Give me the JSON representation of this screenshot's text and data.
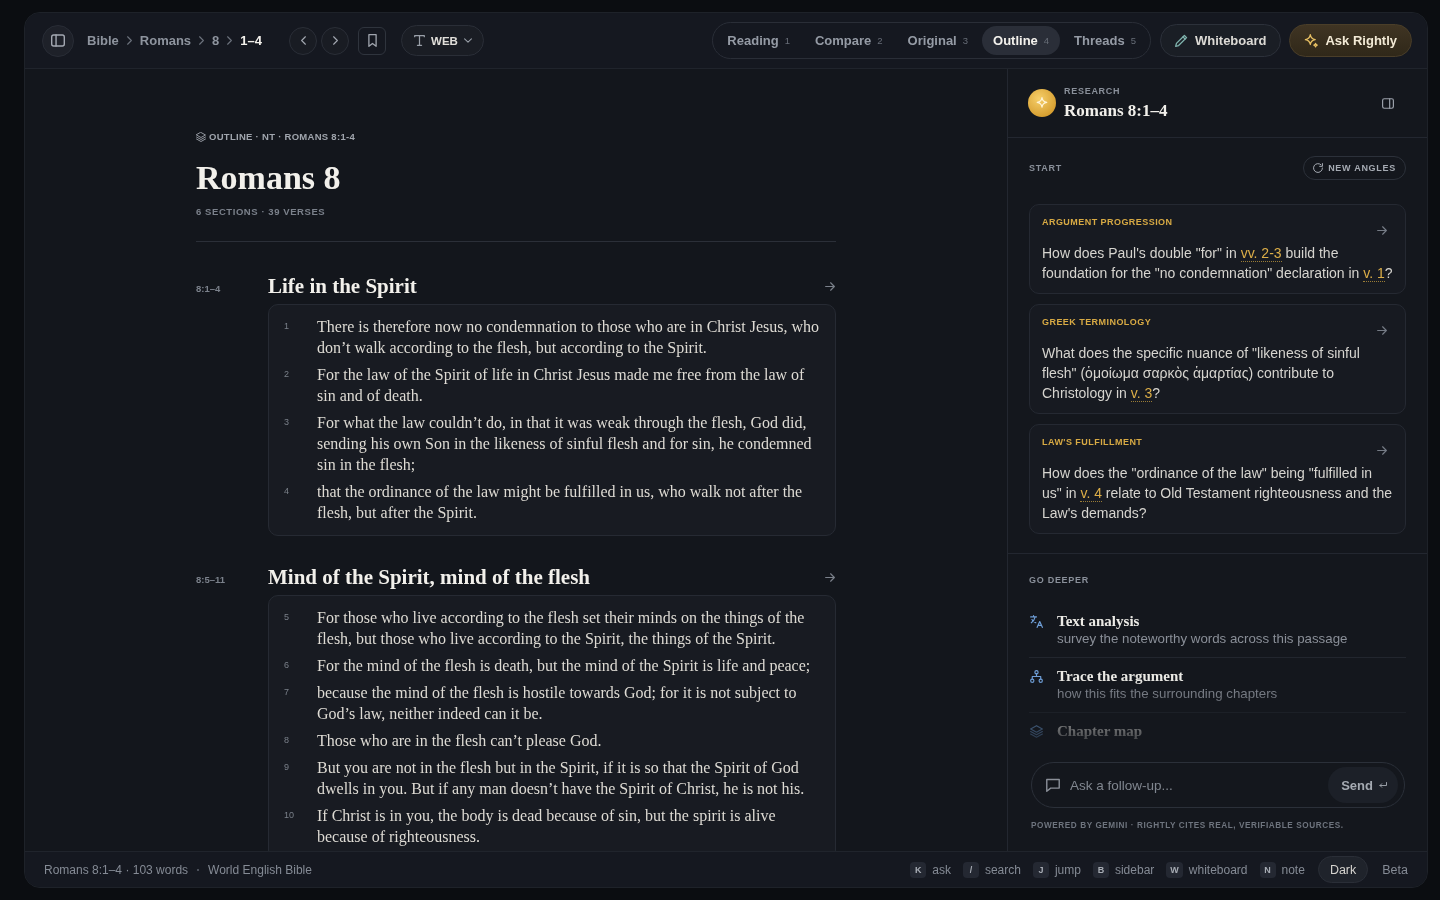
{
  "topbar": {
    "breadcrumbs": [
      {
        "label": "Bible",
        "current": false
      },
      {
        "label": "Romans",
        "current": false
      },
      {
        "label": "8",
        "current": false
      },
      {
        "label": "1–4",
        "current": true
      }
    ],
    "translation": "WEB",
    "tabs": [
      {
        "label": "Reading",
        "count": "1",
        "selected": false
      },
      {
        "label": "Compare",
        "count": "2",
        "selected": false
      },
      {
        "label": "Original",
        "count": "3",
        "selected": false
      },
      {
        "label": "Outline",
        "count": "4",
        "selected": true
      },
      {
        "label": "Threads",
        "count": "5",
        "selected": false
      }
    ],
    "actions": [
      {
        "label": "Whiteboard",
        "kind": "whiteboard"
      },
      {
        "label": "Ask Rightly",
        "kind": "assistant"
      }
    ]
  },
  "outline": {
    "eyebrow": "OUTLINE · NT · ROMANS 8:1-4",
    "title": "Romans 8",
    "meta": "6 SECTIONS · 39 VERSES",
    "sections": [
      {
        "ref": "8:1–4",
        "heading": "Life in the Spirit",
        "verses": [
          {
            "number": "1",
            "text": "There is therefore now no condemnation to those who are in Christ Jesus, who don’t walk according to the flesh, but according to the Spirit."
          },
          {
            "number": "2",
            "text": "For the law of the Spirit of life in Christ Jesus made me free from the law of sin and of death."
          },
          {
            "number": "3",
            "text": "For what the law couldn’t do, in that it was weak through the flesh, God did, sending his own Son in the likeness of sinful flesh and for sin, he condemned sin in the flesh;"
          },
          {
            "number": "4",
            "text": "that the ordinance of the law might be fulfilled in us, who walk not after the flesh, but after the Spirit."
          }
        ]
      },
      {
        "ref": "8:5–11",
        "heading": "Mind of the Spirit, mind of the flesh",
        "verses": [
          {
            "number": "5",
            "text": "For those who live according to the flesh set their minds on the things of the flesh, but those who live according to the Spirit, the things of the Spirit."
          },
          {
            "number": "6",
            "text": "For the mind of the flesh is death, but the mind of the Spirit is life and peace;"
          },
          {
            "number": "7",
            "text": "because the mind of the flesh is hostile towards God; for it is not subject to God’s law, neither indeed can it be."
          },
          {
            "number": "8",
            "text": "Those who are in the flesh can’t please God."
          },
          {
            "number": "9",
            "text": "But you are not in the flesh but in the Spirit, if it is so that the Spirit of God dwells in you. But if any man doesn’t have the Spirit of Christ, he is not his."
          },
          {
            "number": "10",
            "text": "If Christ is in you, the body is dead because of sin, but the spirit is alive because of righteousness."
          }
        ]
      }
    ]
  },
  "research": {
    "eyebrow": "RESEARCH",
    "title": "Romans 8:1–4",
    "start": {
      "label": "START",
      "action": "NEW ANGLES",
      "cards": [
        {
          "category": "ARGUMENT PROGRESSION",
          "question": [
            {
              "kind": "text",
              "text": "How does Paul's double \"for\" in "
            },
            {
              "kind": "ref",
              "text": "vv. 2-3"
            },
            {
              "kind": "text",
              "text": " build the foundation for the \"no condemnation\" declaration in "
            },
            {
              "kind": "ref",
              "text": "v. 1"
            },
            {
              "kind": "text",
              "text": "?"
            }
          ]
        },
        {
          "category": "GREEK TERMINOLOGY",
          "question": [
            {
              "kind": "text",
              "text": "What does the specific nuance of \"likeness of sinful flesh\" (ὁμοίωμα σαρκὸς ἁμαρτίας) contribute to Christology in "
            },
            {
              "kind": "ref",
              "text": "v. 3"
            },
            {
              "kind": "text",
              "text": "?"
            }
          ]
        },
        {
          "category": "LAW'S FULFILLMENT",
          "question": [
            {
              "kind": "text",
              "text": "How does the \"ordinance of the law\" being \"fulfilled in us\" in "
            },
            {
              "kind": "ref",
              "text": "v. 4"
            },
            {
              "kind": "text",
              "text": " relate to Old Testament righteousness and the Law's demands?"
            }
          ]
        }
      ]
    },
    "go_deeper": {
      "label": "GO DEEPER",
      "items": [
        {
          "kind": "text",
          "title": "Text analysis",
          "subtitle": "survey the noteworthy words across this passage"
        },
        {
          "kind": "argument",
          "title": "Trace the argument",
          "subtitle": "how this fits the surrounding chapters"
        },
        {
          "kind": "map",
          "title": "Chapter map"
        }
      ]
    },
    "composer": {
      "placeholder": "Ask a follow-up...",
      "send": "Send"
    },
    "footer": "POWERED BY GEMINI · RIGHTLY CITES REAL, VERIFIABLE SOURCES."
  },
  "status_bar": {
    "passage": "Romans 8:1–4 · 103 words",
    "translation": "World English Bible",
    "shortcuts": [
      {
        "key": "K",
        "label": "ask"
      },
      {
        "key": "/",
        "label": "search"
      },
      {
        "key": "J",
        "label": "jump"
      },
      {
        "key": "B",
        "label": "sidebar"
      },
      {
        "key": "W",
        "label": "whiteboard"
      },
      {
        "key": "N",
        "label": "note"
      }
    ],
    "theme": "Dark",
    "badge": "Beta"
  }
}
